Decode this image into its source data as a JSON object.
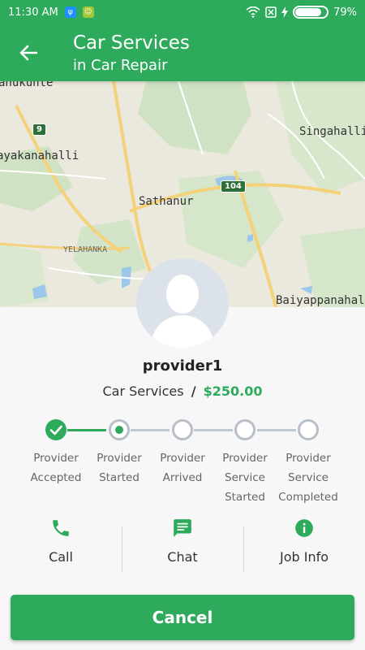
{
  "status_bar": {
    "time": "11:30 AM",
    "battery_text": "79%",
    "battery_level": 0.79
  },
  "header": {
    "back_icon": "arrow-left-icon",
    "title": "Car Services",
    "subtitle": "in Car Repair"
  },
  "map": {
    "labels": [
      "anukunte",
      "ayakanahalli",
      "Sathanur",
      "Singahalli",
      "YELAHANKA",
      "Baiyappanahalli"
    ],
    "shields": [
      "9",
      "104"
    ]
  },
  "provider": {
    "name": "provider1",
    "service": "Car Services",
    "separator": "/",
    "price": "$250.00"
  },
  "steps": [
    {
      "label": "Provider\nAccepted",
      "state": "done"
    },
    {
      "label": "Provider\nStarted",
      "state": "current"
    },
    {
      "label": "Provider\nArrived",
      "state": "pending"
    },
    {
      "label": "Provider\nService\nStarted",
      "state": "pending"
    },
    {
      "label": "Provider\nService\nCompleted",
      "state": "pending"
    }
  ],
  "actions": [
    {
      "label": "Call",
      "icon": "phone-icon"
    },
    {
      "label": "Chat",
      "icon": "chat-icon"
    },
    {
      "label": "Job Info",
      "icon": "info-icon"
    }
  ],
  "cancel_label": "Cancel",
  "colors": {
    "primary": "#2eaa5c",
    "pending": "#b7bfc8"
  }
}
